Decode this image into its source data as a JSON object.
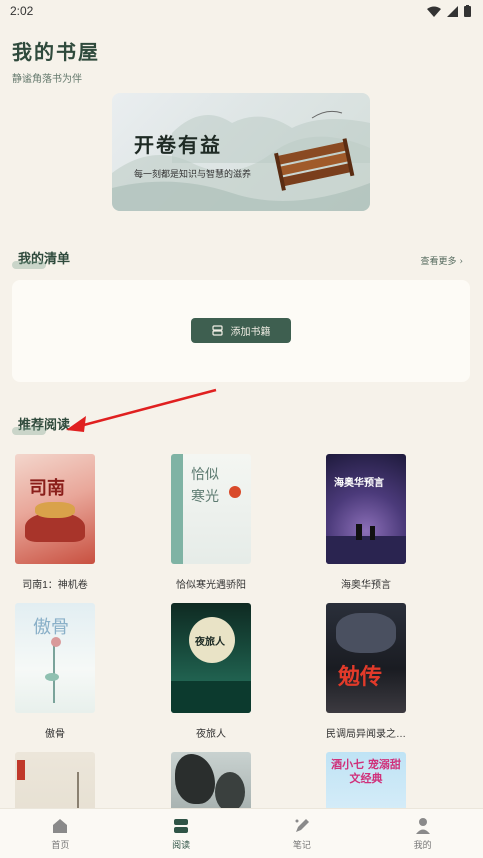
{
  "status": {
    "time": "2:02"
  },
  "header": {
    "title": "我的书屋",
    "subtitle": "静谧角落书为伴"
  },
  "banner": {
    "title": "开卷有益",
    "subtitle": "每一刻都是知识与智慧的滋养"
  },
  "my_list": {
    "heading": "我的清单",
    "see_more": "查看更多 ›",
    "add_button": "添加书籍"
  },
  "recommend": {
    "heading": "推荐阅读",
    "books": [
      {
        "title": "司南1：神机卷",
        "cover_text": "司南"
      },
      {
        "title": "恰似寒光遇骄阳",
        "cover_text": "恰似寒光"
      },
      {
        "title": "海奥华预言",
        "cover_text": "海奥华预言"
      },
      {
        "title": "傲骨",
        "cover_text": "傲骨"
      },
      {
        "title": "夜旅人",
        "cover_text": "夜旅人"
      },
      {
        "title": "民调局异闻录之…",
        "cover_text": "勉传"
      },
      {
        "title": "",
        "cover_text": ""
      },
      {
        "title": "",
        "cover_text": ""
      },
      {
        "title": "",
        "cover_text": "酒小七 宠溺甜文经典"
      }
    ]
  },
  "tabs": [
    {
      "label": "首页",
      "icon": "home-icon"
    },
    {
      "label": "阅读",
      "icon": "book-stack-icon"
    },
    {
      "label": "笔记",
      "icon": "pen-icon"
    },
    {
      "label": "我的",
      "icon": "person-icon"
    }
  ],
  "colors": {
    "accent": "#3e5f50",
    "background": "#f6f2ea",
    "arrow": "#e02020"
  }
}
